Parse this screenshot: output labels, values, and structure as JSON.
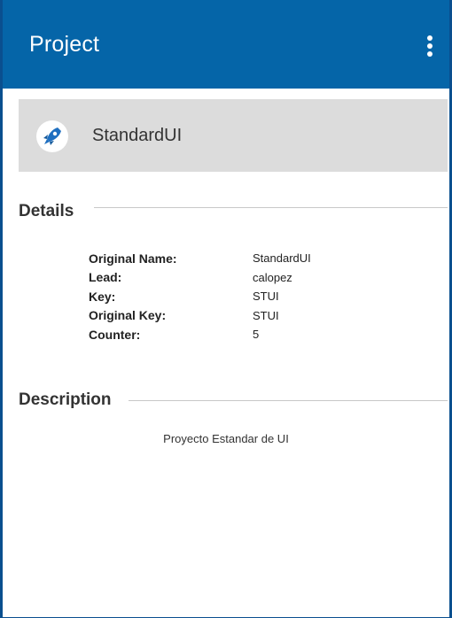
{
  "appbar": {
    "title": "Project",
    "menu_icon": "more-vert-icon",
    "background_color": "#0565a8"
  },
  "project": {
    "name": "StandardUI",
    "icon": "rocket-icon"
  },
  "details": {
    "heading": "Details",
    "rows": [
      {
        "label": "Original Name:",
        "value": "StandardUI"
      },
      {
        "label": "Lead:",
        "value": "calopez"
      },
      {
        "label": "Key:",
        "value": "STUI"
      },
      {
        "label": "Original Key:",
        "value": "STUI"
      },
      {
        "label": "Counter:",
        "value": "5"
      }
    ]
  },
  "description": {
    "heading": "Description",
    "text": "Proyecto Estandar de UI"
  }
}
